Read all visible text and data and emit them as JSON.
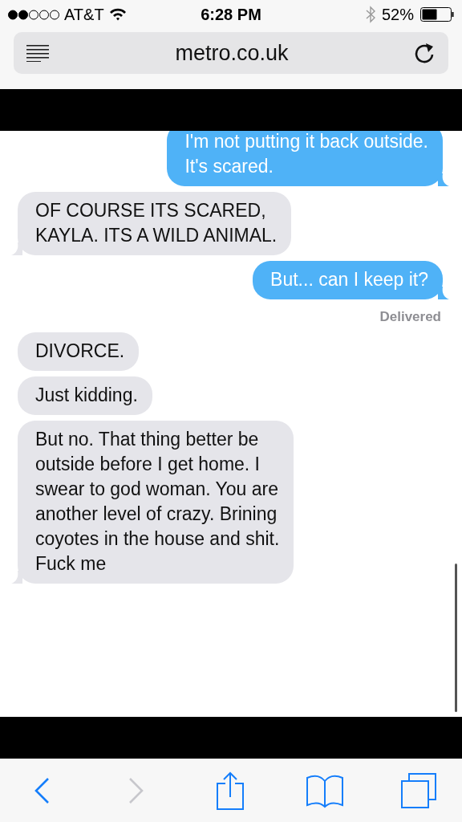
{
  "status_bar": {
    "carrier": "AT&T",
    "time": "6:28 PM",
    "battery": "52%"
  },
  "address_bar": {
    "url": "metro.co.uk"
  },
  "messages": [
    {
      "kind": "sent",
      "text": "I'm not putting it back outside.\nIt's scared.",
      "tail": true
    },
    {
      "kind": "received",
      "text": "OF COURSE ITS SCARED,\nKAYLA. ITS A WILD ANIMAL.",
      "tail": true
    },
    {
      "kind": "sent",
      "text": "But... can I keep it?",
      "tail": true
    },
    {
      "kind": "status",
      "text": "Delivered"
    },
    {
      "kind": "received",
      "text": "DIVORCE.",
      "tail": false
    },
    {
      "kind": "received",
      "text": "Just kidding.",
      "tail": false
    },
    {
      "kind": "received",
      "text": "But no. That thing better be\noutside before I get home. I\nswear to god woman. You are\nanother level of crazy. Brining\ncoyotes in the house and shit.\nFuck me",
      "tail": true
    }
  ],
  "toolbar": {
    "back_disabled": false,
    "forward_disabled": true
  }
}
